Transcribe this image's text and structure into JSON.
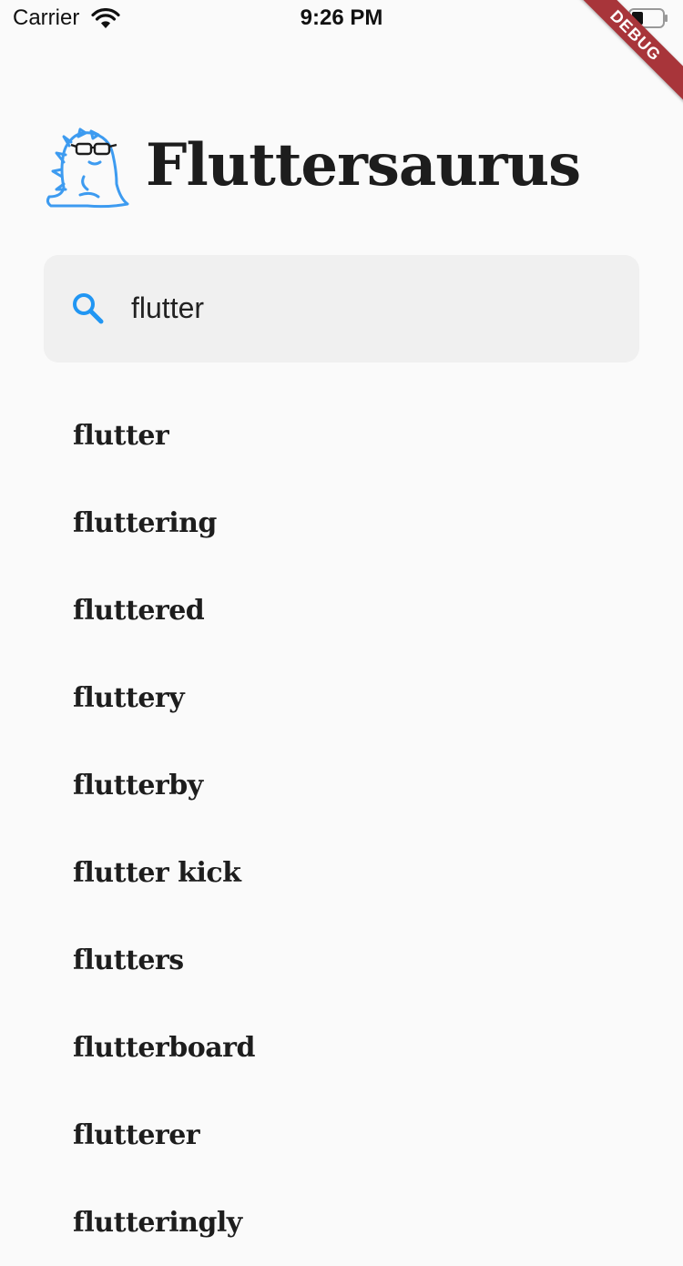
{
  "status_bar": {
    "carrier": "Carrier",
    "time": "9:26 PM",
    "debug_label": "DEBUG"
  },
  "header": {
    "logo_icon": "dinosaur-with-glasses-icon",
    "title": "Fluttersaurus"
  },
  "search": {
    "icon": "search-icon",
    "value": "flutter",
    "accent_color": "#2196f3"
  },
  "results": [
    {
      "label": "flutter"
    },
    {
      "label": "fluttering"
    },
    {
      "label": "fluttered"
    },
    {
      "label": "fluttery"
    },
    {
      "label": "flutterby"
    },
    {
      "label": "flutter kick"
    },
    {
      "label": "flutters"
    },
    {
      "label": "flutterboard"
    },
    {
      "label": "flutterer"
    },
    {
      "label": "flutteringly"
    }
  ]
}
